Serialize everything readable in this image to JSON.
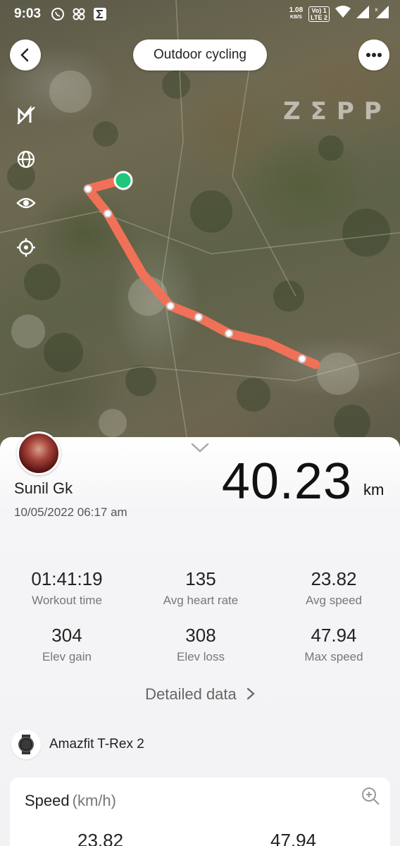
{
  "status_bar": {
    "time": "9:03",
    "net_speed_value": "1.08",
    "net_speed_unit": "KB/S",
    "volte_top": "Vo) 1",
    "volte_bottom": "LTE 2"
  },
  "header": {
    "title": "Outdoor cycling",
    "watermark": "ZΣPP"
  },
  "map_tools": [
    "heatmap-toggle-icon",
    "globe-icon",
    "eye-icon",
    "locate-icon"
  ],
  "route": {
    "color": "#f07157",
    "start_marker_color": "#1ec77c"
  },
  "summary": {
    "user_name": "Sunil Gk",
    "date_time": "10/05/2022 06:17 am",
    "distance": "40.23",
    "distance_unit": "km"
  },
  "stats": [
    {
      "value": "01:41:19",
      "label": "Workout time"
    },
    {
      "value": "135",
      "label": "Avg heart rate"
    },
    {
      "value": "23.82",
      "label": "Avg speed"
    },
    {
      "value": "304",
      "label": "Elev gain"
    },
    {
      "value": "308",
      "label": "Elev loss"
    },
    {
      "value": "47.94",
      "label": "Max speed"
    }
  ],
  "detailed_data_label": "Detailed data",
  "device": {
    "name": "Amazfit T-Rex 2"
  },
  "speed_card": {
    "title": "Speed",
    "unit": "(km/h)",
    "avg_value": "23.82",
    "max_value": "47.94"
  }
}
